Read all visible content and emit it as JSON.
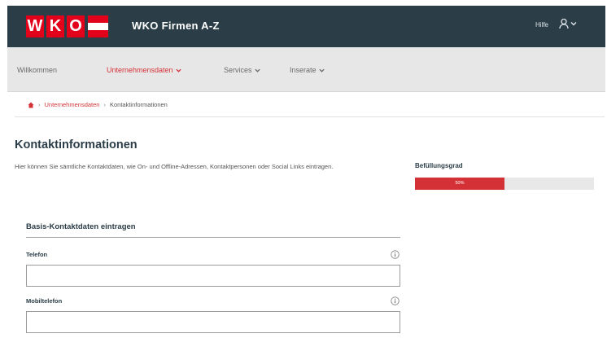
{
  "header": {
    "logo_letters": [
      "W",
      "K",
      "O"
    ],
    "logo_flag_colors": [
      "#e2001a",
      "#ffffff",
      "#e2001a"
    ],
    "app_title": "WKO Firmen A-Z",
    "help_label": "Hilfe",
    "user_icon": "user-icon",
    "user_menu_chevron": "chevron-down-icon"
  },
  "nav": {
    "items": [
      {
        "label": "Willkommen",
        "active": false,
        "has_dropdown": false
      },
      {
        "label": "Unternehmensdaten",
        "active": true,
        "has_dropdown": true
      },
      {
        "label": "Services",
        "active": false,
        "has_dropdown": true
      },
      {
        "label": "Inserate",
        "active": false,
        "has_dropdown": true
      }
    ]
  },
  "breadcrumb": {
    "home_icon": "home-icon",
    "items": [
      "Unternehmensdaten",
      "Kontaktinformationen"
    ]
  },
  "page": {
    "title": "Kontaktinformationen",
    "intro": "Hier können Sie sämtliche Kontaktdaten, wie On- und Offline-Adressen, Kontaktpersonen oder Social Links eintragen."
  },
  "progress": {
    "label": "Befüllungsgrad",
    "value_percent": 50,
    "value_text": "50%"
  },
  "section": {
    "title": "Basis-Kontaktdaten eintragen"
  },
  "fields": {
    "telefon": {
      "label": "Telefon",
      "value": "",
      "info_icon": "info-icon"
    },
    "mobiltelefon": {
      "label": "Mobiltelefon",
      "value": "",
      "info_icon": "info-icon"
    }
  },
  "colors": {
    "header_bg": "#2b3d47",
    "brand_red": "#e2001a",
    "accent_red": "#d43137",
    "nav_bg": "#e7e7e7",
    "progress_track": "#e8e8e8"
  }
}
